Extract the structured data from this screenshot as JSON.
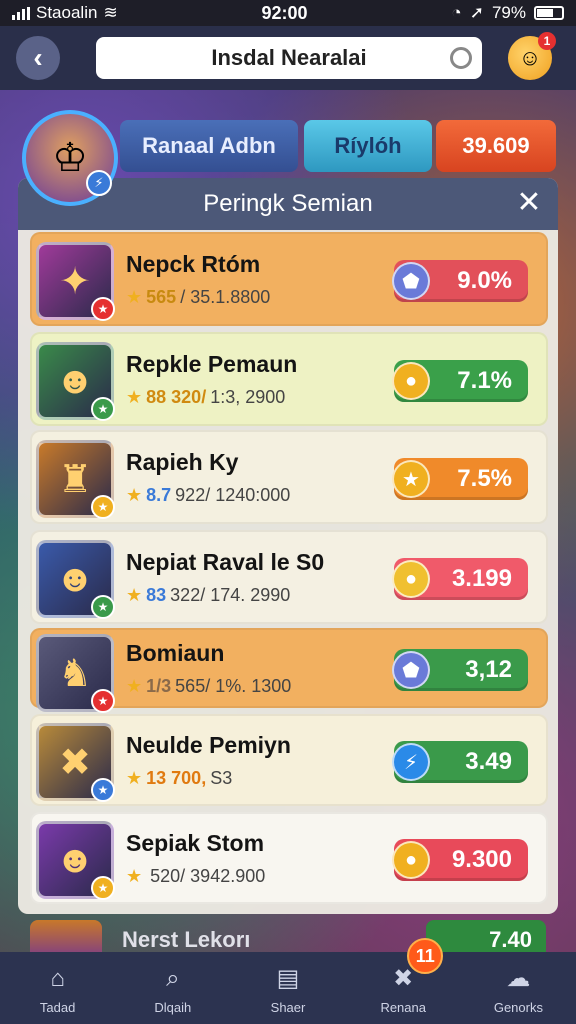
{
  "status_bar": {
    "carrier": "Staoalin",
    "time": "92:00",
    "battery": "79%"
  },
  "header": {
    "title": "Insdal Nearalai",
    "notification_count": "1"
  },
  "tabs": [
    {
      "label": "Ranaal Adbn"
    },
    {
      "label": "Ríylóh"
    },
    {
      "label": "39.609"
    }
  ],
  "panel": {
    "title": "Peringk Semian"
  },
  "rows": [
    {
      "name": "Nepck Rtóm",
      "sub_accent": "565",
      "sub_rest": "/ 35.1.8800",
      "value": "9.0%",
      "colors": {
        "bg": "#f2b060",
        "pill": "#e2505a",
        "icon": "#a03a9a"
      }
    },
    {
      "name": "Repkle Pemaun",
      "sub_accent": "88 320/",
      "sub_rest": "1:3, 2900",
      "value": "7.1%",
      "colors": {
        "bg": "#eef2c4",
        "pill": "#3aa04a",
        "icon": "#3a8a4a"
      }
    },
    {
      "name": "Rapieh Ky",
      "sub_accent": "8.7",
      "sub_rest": "922/ 1240:000",
      "value": "7.5%",
      "colors": {
        "bg": "#f4f0e0",
        "pill": "#f08a2a",
        "icon": "#c87a2a"
      }
    },
    {
      "name": "Nepiat Raval le S0",
      "sub_accent": "83",
      "sub_rest": "322/ 174. 2990",
      "value": "3.199",
      "colors": {
        "bg": "#f4f0e2",
        "pill": "#f05a6a",
        "icon": "#3a5aaa"
      }
    },
    {
      "name": "Bomiaun",
      "sub_accent": "1/3",
      "sub_rest": "565/ 1%. 1300",
      "value": "3,12",
      "colors": {
        "bg": "#f2b060",
        "pill": "#3a9a4a",
        "icon": "#5a5a7a"
      }
    },
    {
      "name": "Neulde Pemiyn",
      "sub_accent": "13 700,",
      "sub_rest": "S3",
      "value": "3.49",
      "colors": {
        "bg": "#f6f0da",
        "pill": "#3a9a4a",
        "icon": "#b88a3a"
      }
    },
    {
      "name": "Sepiak Stom",
      "sub_accent": "",
      "sub_rest": "520/ 3942.900",
      "value": "9.300",
      "colors": {
        "bg": "#f8f6f0",
        "pill": "#e84a5a",
        "icon": "#7a3aaa"
      }
    }
  ],
  "peek_row": {
    "name": "Nerst Lekorı",
    "value": "7.40"
  },
  "bottom_nav": [
    {
      "label": "Tadad",
      "icon": "home-icon"
    },
    {
      "label": "Dlqaih",
      "icon": "search-icon"
    },
    {
      "label": "Shaer",
      "icon": "chart-icon"
    },
    {
      "label": "Renana",
      "icon": "game-icon",
      "badge": "11"
    },
    {
      "label": "Genorks",
      "icon": "chat-icon"
    }
  ]
}
